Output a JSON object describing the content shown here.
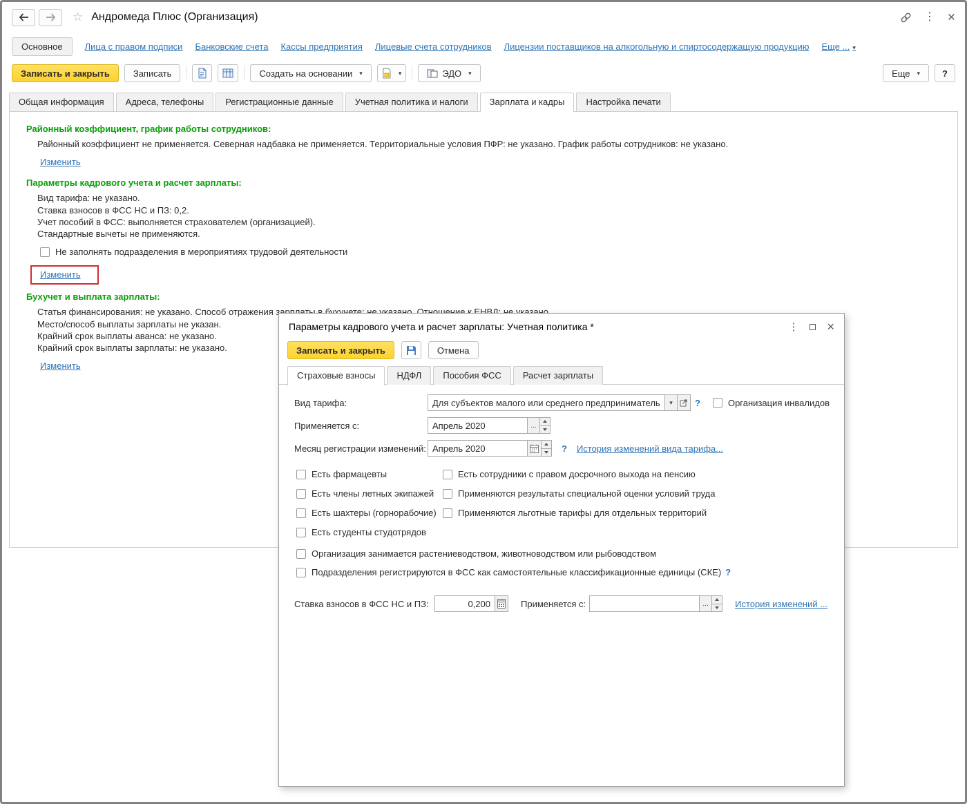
{
  "colors": {
    "accent_yellow": "#FDD22E",
    "link_blue": "#2E74B5",
    "heading_green": "#0AA00A",
    "highlight_red": "#CF2E2E"
  },
  "glyphs": {
    "star": "☆",
    "menu_dots": "⋮",
    "close": "×",
    "dropdown": "▾",
    "dots": "...",
    "help": "?"
  },
  "titlebar": {
    "title": "Андромеда Плюс (Организация)"
  },
  "nav": {
    "active": "Основное",
    "links": [
      "Лица с правом подписи",
      "Банковские счета",
      "Кассы предприятия",
      "Лицевые счета сотрудников",
      "Лицензии поставщиков на алкогольную и спиртосодержащую продукцию"
    ],
    "more": "Еще ..."
  },
  "toolbar": {
    "save_close": "Записать и закрыть",
    "save": "Записать",
    "create_based_on": "Создать на основании",
    "edo": "ЭДО",
    "more": "Еще",
    "help": "?"
  },
  "tabs": {
    "items": [
      "Общая информация",
      "Адреса, телефоны",
      "Регистрационные данные",
      "Учетная политика и налоги",
      "Зарплата и кадры",
      "Настройка печати"
    ],
    "active": "Зарплата и кадры"
  },
  "sections": {
    "district": {
      "heading": "Районный коэффициент, график работы сотрудников:",
      "text": "Районный коэффициент не применяется. Северная надбавка не применяется. Территориальные условия ПФР: не указано. График работы сотрудников: не указано.",
      "change_link": "Изменить"
    },
    "hr": {
      "heading": "Параметры кадрового учета и расчет зарплаты:",
      "line1": "Вид тарифа: не указано.",
      "line2": "Ставка взносов в ФСС НС и ПЗ: 0,2.",
      "line3": "Учет пособий в ФСС: выполняется страхователем (организацией).",
      "line4": "Стандартные вычеты не применяются.",
      "checkbox": "Не заполнять подразделения в мероприятиях трудовой деятельности",
      "change_link": "Изменить"
    },
    "accounting": {
      "heading": "Бухучет и выплата зарплаты:",
      "line1": "Статья финансирования: не указано. Способ отражения зарплаты в бухучете: не указано. Отношение к ЕНВД: не указано..",
      "line2": "Место/способ выплаты зарплаты не указан.",
      "line3": "Крайний срок выплаты аванса: не указано.",
      "line4": "Крайний срок выплаты зарплаты: не указано.",
      "change_link": "Изменить"
    }
  },
  "modal": {
    "title": "Параметры кадрового учета и расчет зарплаты: Учетная политика *",
    "toolbar": {
      "save_close": "Записать и закрыть",
      "cancel": "Отмена"
    },
    "tabs": [
      "Страховые взносы",
      "НДФЛ",
      "Пособия ФСС",
      "Расчет зарплаты"
    ],
    "active_tab": "Страховые взносы",
    "tariff": {
      "label": "Вид тарифа:",
      "value": "Для субъектов малого или среднего предпринимательс",
      "org_invalid_checkbox": "Организация инвалидов"
    },
    "applies_from": {
      "label": "Применяется с:",
      "value": "Апрель 2020"
    },
    "reg_month": {
      "label": "Месяц регистрации изменений:",
      "value": "Апрель 2020",
      "history_link": "История изменений вида тарифа..."
    },
    "checkboxes_left": [
      "Есть фармацевты",
      "Есть члены летных экипажей",
      "Есть шахтеры (горнорабочие)",
      "Есть студенты студотрядов"
    ],
    "checkboxes_right": [
      "Есть сотрудники с правом досрочного выхода на пенсию",
      "Применяются результаты специальной оценки условий труда",
      "Применяются льготные тарифы для отдельных территорий"
    ],
    "checkbox_agro": "Организация занимается растениеводством, животноводством или рыбоводством",
    "checkbox_ske": "Подразделения регистрируются в ФСС как самостоятельные классификационные единицы (СКЕ)",
    "rate": {
      "label": "Ставка взносов в ФСС НС и ПЗ:",
      "value": "0,200",
      "applies_label": "Применяется с:",
      "applies_value": "",
      "history_link": "История изменений ..."
    }
  }
}
